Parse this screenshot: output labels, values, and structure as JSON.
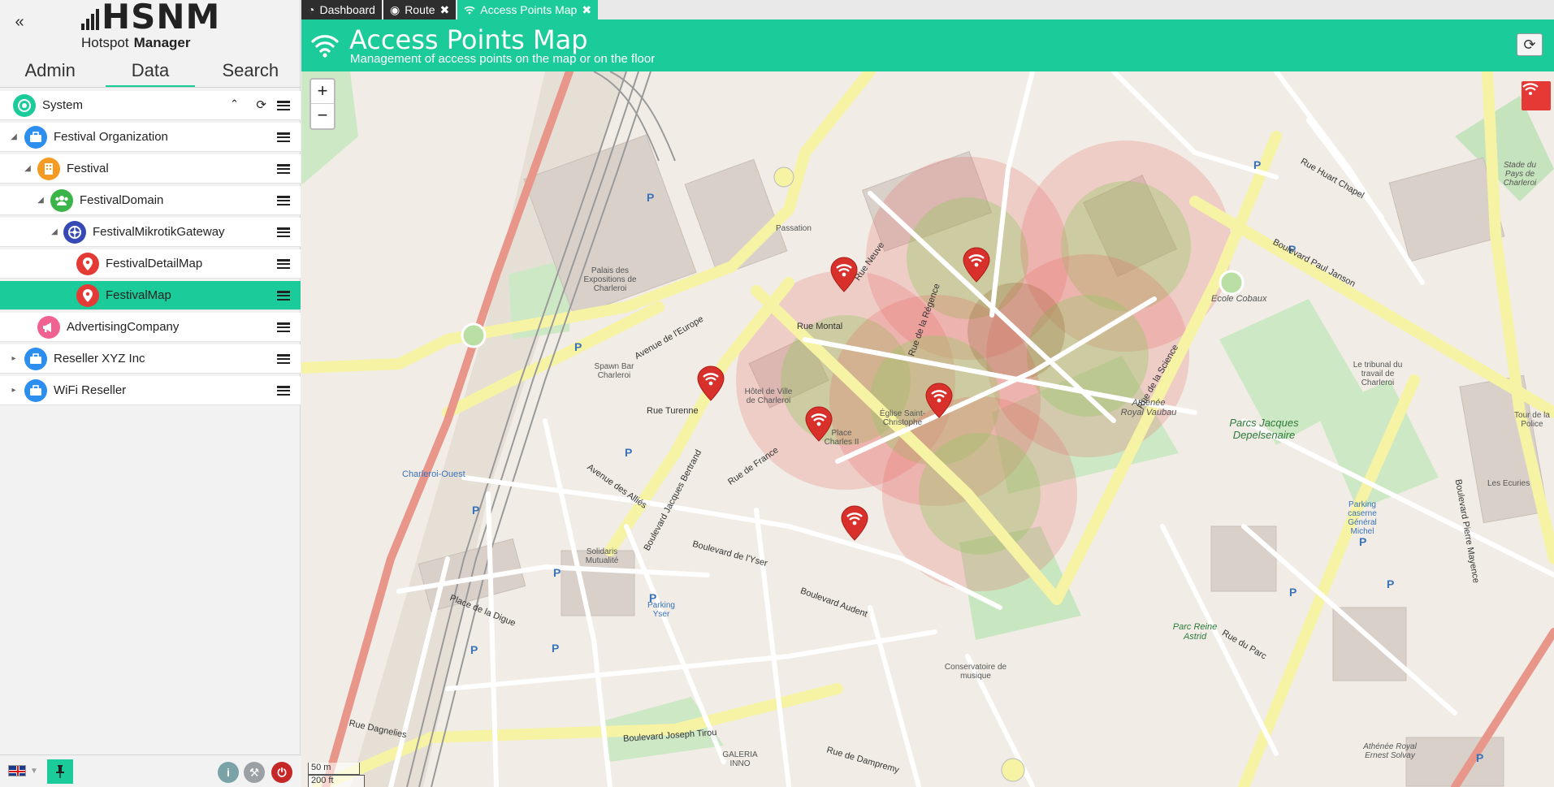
{
  "app": {
    "logo_text": "HSNM",
    "logo_sub1": "Hotspot",
    "logo_sub2": "Manager"
  },
  "sidebar": {
    "tabs": [
      "Admin",
      "Data",
      "Search"
    ],
    "active_tab": "Data",
    "tree": [
      {
        "label": "System",
        "icon": "system-icon"
      },
      {
        "label": "Festival Organization",
        "icon": "briefcase-icon"
      },
      {
        "label": "Festival",
        "icon": "building-icon"
      },
      {
        "label": "FestivalDomain",
        "icon": "users-icon"
      },
      {
        "label": "FestivalMikrotikGateway",
        "icon": "gateway-icon"
      },
      {
        "label": "FestivalDetailMap",
        "icon": "map-pin-icon"
      },
      {
        "label": "FestivalMap",
        "icon": "map-pin-icon",
        "selected": true
      },
      {
        "label": "AdvertisingCompany",
        "icon": "megaphone-icon"
      },
      {
        "label": "Reseller XYZ Inc",
        "icon": "briefcase-icon"
      },
      {
        "label": "WiFi Reseller",
        "icon": "briefcase-icon"
      }
    ]
  },
  "top_tabs": [
    {
      "label": "Dashboard",
      "icon": "dashboard-icon"
    },
    {
      "label": "Route",
      "icon": "route-icon"
    },
    {
      "label": "Access Points Map",
      "icon": "wifi-icon",
      "active": true
    }
  ],
  "header": {
    "title": "Access Points Map",
    "subtitle": "Management of access points on the map or on the floor"
  },
  "map": {
    "zoom_in": "+",
    "zoom_out": "−",
    "scale_metric": "50 m",
    "scale_imperial": "200 ft",
    "access_point_count": 6,
    "labels": {
      "park_name": "Parcs Jacques Depelsenaire",
      "parc_reine": "Parc Reine Astrid",
      "athenee": "Athénée Royal Vaubau",
      "palais": "Palais des Expositions de Charleroi",
      "ecole": "Ecole Cobaux",
      "stade": "Stade du Pays de Charleroi",
      "r_turenne": "Rue Turenne",
      "r_montal": "Rue Montal",
      "r_dampremy": "Rue de Dampremy",
      "r_parc": "Rue du Parc",
      "r_yser": "Boulevard de l'Yser",
      "b_janson": "Boulevard Paul Janson",
      "b_audent": "Boulevard Audent",
      "b_bertrand": "Boulevard Jacques Bertrand",
      "r_dignes": "Rue Dagnelies",
      "r_europe": "Avenue de l'Europe",
      "r_allies": "Avenue des Alliés",
      "r_digue": "Place de la Digue",
      "r_regence": "Rue de la Régence",
      "parking_yser": "Parking Yser",
      "passation": "Passation",
      "eglise": "Église Saint-Christophe",
      "charleroi_ouest": "Charleroi-Ouest",
      "hotel_ville": "Hôtel de Ville de Charleroi",
      "spawn": "Spawn Bar Charleroi",
      "solidaris": "Solidaris Mutualité",
      "galeria": "GALERIA INNO",
      "b_tirou": "Boulevard Joseph Tirou",
      "r_science": "Rue de la Science",
      "r_neuve": "Rue Neuve",
      "r_france": "Rue de France",
      "place_charles": "Place Charles II",
      "conservatoire": "Conservatoire de musique",
      "athenee2": "Athénée Royal Ernest Solvay",
      "bd_mayence": "Boulevard Pierre Mayence",
      "parking_caserne": "Parking caserne Général Michel",
      "r_huart": "Rue Huart Chapel",
      "tribunal": "Le tribunal du travail de Charleroi",
      "tour_police": "Tour de la Police",
      "les_ecuries": "Les Ecuries"
    }
  },
  "colors": {
    "accent": "#1bcc9a",
    "marker": "#e53935",
    "dark_tab": "#2e2e2e"
  }
}
